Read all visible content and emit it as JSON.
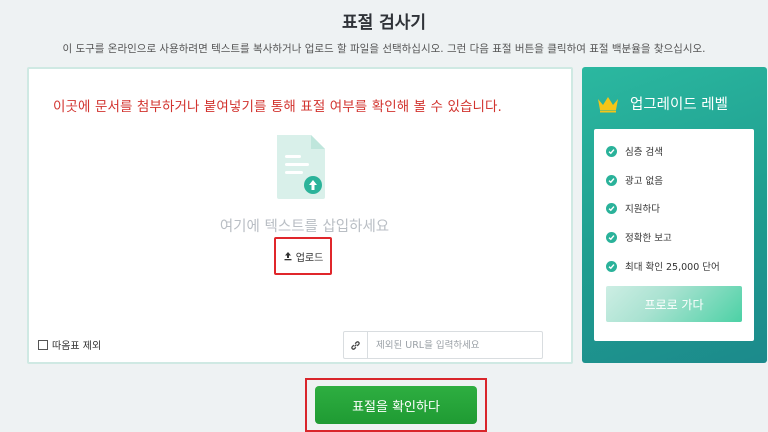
{
  "header": {
    "title": "표절 검사기",
    "subtitle": "이 도구를 온라인으로 사용하려면 텍스트를 복사하거나 업로드 할 파일을 선택하십시오. 그런 다음 표절 버튼을 클릭하여 표절 백분율을 찾으십시오."
  },
  "editor": {
    "notice": "이곳에 문서를 첨부하거나 붙여넣기를 통해 표절 여부를 확인해 볼 수 있습니다.",
    "placeholder": "여기에 텍스트를 삽입하세요",
    "upload_label": "업로드",
    "exclude_quotes_label": "따옴표 제외",
    "url_placeholder": "제외된 URL을 입력하세요"
  },
  "upgrade": {
    "title": "업그레이드 레벨",
    "features": [
      "심층 검색",
      "광고 없음",
      "지원하다",
      "정확한 보고",
      "최대 확인 25,000 단어"
    ],
    "button_label": "프로로 가다"
  },
  "action": {
    "check_label": "표절을 확인하다"
  },
  "colors": {
    "accent_green": "#1f9b33",
    "teal": "#2bb8a0",
    "notice_red": "#d2342f",
    "crown_gold": "#f5c518"
  }
}
